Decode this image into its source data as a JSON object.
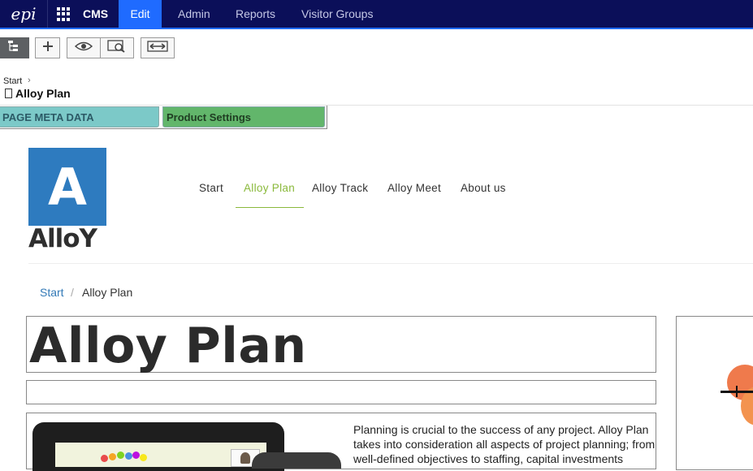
{
  "topbar": {
    "logo_text": "epi",
    "product": "CMS",
    "tabs": [
      {
        "label": "Edit",
        "active": true
      },
      {
        "label": "Admin",
        "active": false
      },
      {
        "label": "Reports",
        "active": false
      },
      {
        "label": "Visitor Groups",
        "active": false
      }
    ],
    "accent": "#1f6bff",
    "background": "#0b0f59"
  },
  "toolbar": {
    "buttons": [
      {
        "icon": "page-tree-icon"
      },
      {
        "icon": "plus-icon"
      },
      {
        "icon": "eye-icon"
      },
      {
        "icon": "preview-magnify-icon"
      },
      {
        "icon": "compare-arrows-icon"
      }
    ]
  },
  "breadcrumb": {
    "start": "Start",
    "current_page": "Alloy Plan"
  },
  "edit_tabs": [
    {
      "label": "PAGE META DATA",
      "color": "#7cc9c8"
    },
    {
      "label": "Product Settings",
      "color": "#62b66b"
    }
  ],
  "site": {
    "logo_letter": "A",
    "logo_word": "AlloY",
    "logo_color": "#2e7bbf",
    "nav": [
      {
        "label": "Start",
        "active": false
      },
      {
        "label": "Alloy Plan",
        "active": true
      },
      {
        "label": "Alloy Track",
        "active": false
      },
      {
        "label": "Alloy Meet",
        "active": false
      },
      {
        "label": "About us",
        "active": false
      }
    ],
    "nav_active_color": "#8ab93b",
    "crumb": {
      "start": "Start",
      "separator": "/",
      "current": "Alloy Plan"
    },
    "page_heading": "Alloy Plan",
    "intro_text": "Planning is crucial to the success of any project. Alloy Plan takes into consideration all aspects of project planning; from well-defined objectives to staffing, capital investments"
  }
}
